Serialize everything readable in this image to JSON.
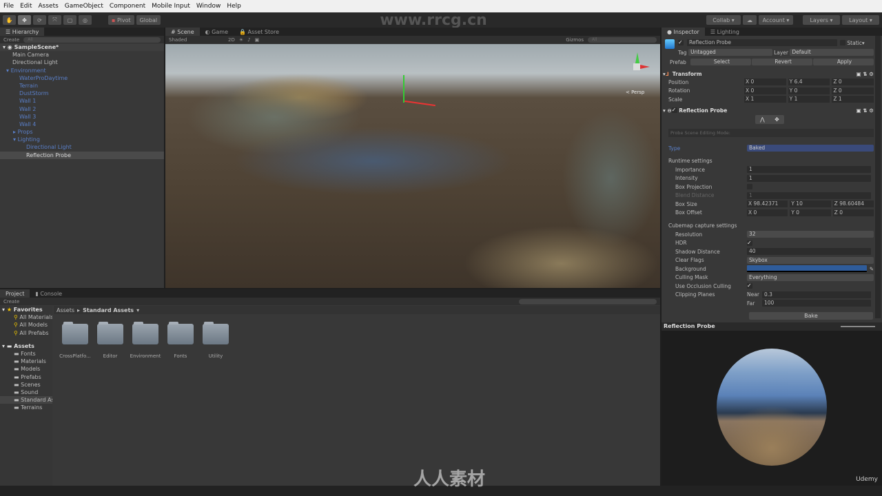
{
  "menu": [
    "File",
    "Edit",
    "Assets",
    "GameObject",
    "Component",
    "Mobile Input",
    "Window",
    "Help"
  ],
  "toolbar": {
    "pivot": "Pivot",
    "global": "Global",
    "collab": "Collab",
    "account": "Account",
    "layers": "Layers",
    "layout": "Layout",
    "watermark": "www.rrcg.cn"
  },
  "hierarchy": {
    "tab": "Hierarchy",
    "create": "Create",
    "search_placeholder": "All",
    "scene": "SampleScene*",
    "items": [
      {
        "label": "Main Camera",
        "indent": 1
      },
      {
        "label": "Directional Light",
        "indent": 1
      },
      {
        "label": "Environment",
        "indent": 1,
        "prefab": true,
        "arrow": "open"
      },
      {
        "label": "WaterProDaytime",
        "indent": 2,
        "prefab": true
      },
      {
        "label": "Terrain",
        "indent": 2,
        "prefab": true
      },
      {
        "label": "DustStorm",
        "indent": 2,
        "prefab": true
      },
      {
        "label": "Wall 1",
        "indent": 2,
        "prefab": true
      },
      {
        "label": "Wall 2",
        "indent": 2,
        "prefab": true
      },
      {
        "label": "Wall 3",
        "indent": 2,
        "prefab": true
      },
      {
        "label": "Wall 4",
        "indent": 2,
        "prefab": true
      },
      {
        "label": "Props",
        "indent": 2,
        "prefab": true,
        "arrow": "closed"
      },
      {
        "label": "Lighting",
        "indent": 2,
        "prefab": true,
        "arrow": "open"
      },
      {
        "label": "Directional Light",
        "indent": 3,
        "prefab": true
      },
      {
        "label": "Reflection Probe",
        "indent": 3,
        "selected": true
      }
    ]
  },
  "scene": {
    "tabs": [
      "Scene",
      "Game",
      "Asset Store"
    ],
    "shading": "Shaded",
    "mode2d": "2D",
    "gizmos": "Gizmos",
    "search_placeholder": "All",
    "persp": "< Persp"
  },
  "project": {
    "tabs": [
      "Project",
      "Console"
    ],
    "create": "Create",
    "favorites": "Favorites",
    "fav_items": [
      "All Materials",
      "All Models",
      "All Prefabs"
    ],
    "assets": "Assets",
    "asset_items": [
      "Fonts",
      "Materials",
      "Models",
      "Prefabs",
      "Scenes",
      "Sound",
      "Standard Assets",
      "Terrains"
    ],
    "breadcrumb": [
      "Assets",
      "Standard Assets"
    ],
    "folders": [
      "CrossPlatfo...",
      "Editor",
      "Environment",
      "Fonts",
      "Utility"
    ]
  },
  "inspector": {
    "tabs": [
      "Inspector",
      "Lighting"
    ],
    "object_name": "Reflection Probe",
    "static": "Static",
    "tag_label": "Tag",
    "tag": "Untagged",
    "layer_label": "Layer",
    "layer": "Default",
    "prefab_label": "Prefab",
    "prefab_buttons": [
      "Select",
      "Revert",
      "Apply"
    ],
    "transform": {
      "title": "Transform",
      "position": [
        "0",
        "6.4",
        "0"
      ],
      "rotation": [
        "0",
        "0",
        "0"
      ],
      "scale": [
        "1",
        "1",
        "1"
      ],
      "labels": [
        "Position",
        "Rotation",
        "Scale"
      ]
    },
    "probe": {
      "title": "Reflection Probe",
      "editing_mode": "Probe Scene Editing Mode:",
      "type_label": "Type",
      "type": "Baked",
      "runtime": "Runtime settings",
      "importance_label": "Importance",
      "importance": "1",
      "intensity_label": "Intensity",
      "intensity": "1",
      "box_projection": "Box Projection",
      "blend_label": "Blend Distance",
      "blend": "1",
      "box_size_label": "Box Size",
      "box_size": [
        "98.42371",
        "10",
        "98.60484"
      ],
      "box_offset_label": "Box Offset",
      "box_offset": [
        "0",
        "0",
        "0"
      ],
      "cubemap": "Cubemap capture settings",
      "resolution_label": "Resolution",
      "resolution": "32",
      "hdr_label": "HDR",
      "shadow_label": "Shadow Distance",
      "shadow": "40",
      "clear_label": "Clear Flags",
      "clear": "Skybox",
      "background_label": "Background",
      "background_color": "#2f5c9a",
      "culling_label": "Culling Mask",
      "culling": "Everything",
      "occlusion_label": "Use Occlusion Culling",
      "clipping_label": "Clipping Planes",
      "near_label": "Near",
      "near": "0.3",
      "far_label": "Far",
      "far": "100",
      "bake": "Bake"
    }
  },
  "preview": {
    "title": "Reflection Probe",
    "brand": "Udemy"
  },
  "footer_watermark": "人人素材"
}
